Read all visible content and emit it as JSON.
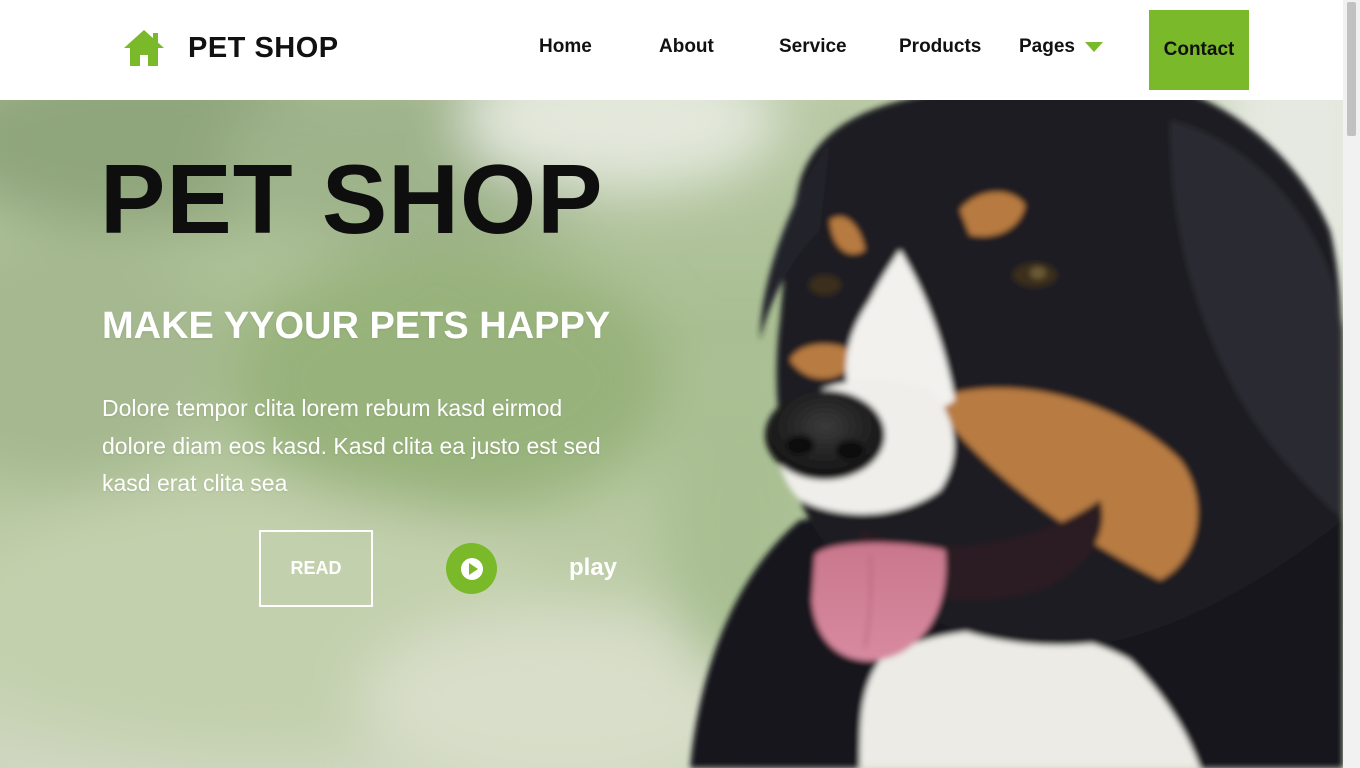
{
  "brand": {
    "name": "PET SHOP",
    "icon": "home-icon",
    "icon_color": "#7ab929"
  },
  "nav": {
    "items": [
      {
        "label": "Home"
      },
      {
        "label": "About"
      },
      {
        "label": "Service"
      },
      {
        "label": "Products"
      },
      {
        "label": "Pages"
      }
    ],
    "dropdown_icon": "caret-down-icon",
    "contact_label": "Contact"
  },
  "hero": {
    "title": "PET SHOP",
    "subtitle": "MAKE YYOUR PETS HAPPY",
    "description": "Dolore tempor clita lorem rebum kasd eirmod dolore diam eos kasd. Kasd clita ea justo est sed kasd erat clita sea",
    "read_label": "READ",
    "play_icon": "play-icon",
    "play_label": "play",
    "image": "dog-photo"
  },
  "colors": {
    "accent": "#7ab929",
    "text_dark": "#111111",
    "text_light": "#ffffff"
  }
}
